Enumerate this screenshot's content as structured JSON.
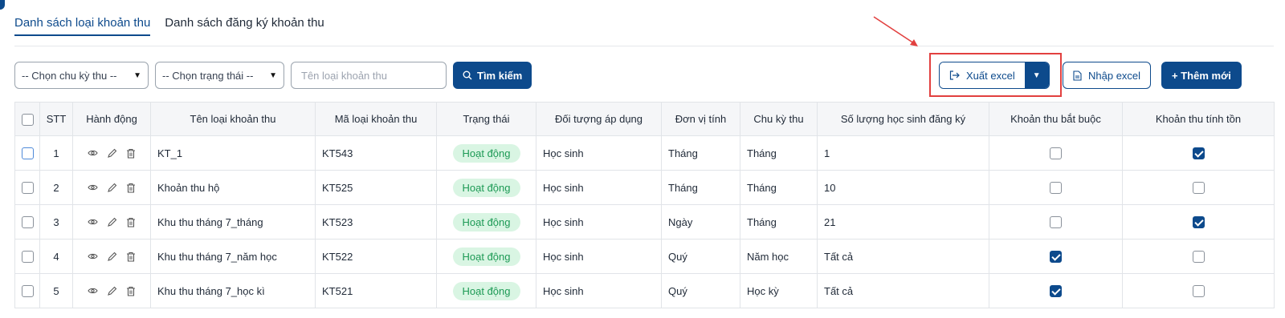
{
  "tabs": [
    {
      "label": "Danh sách loại khoản thu",
      "active": true
    },
    {
      "label": "Danh sách đăng ký khoản thu",
      "active": false
    }
  ],
  "filters": {
    "cycle_select": "-- Chọn chu kỳ thu --",
    "status_select": "-- Chọn trạng thái --",
    "name_placeholder": "Tên loại khoản thu",
    "search_label": "Tìm kiếm"
  },
  "actions": {
    "export_label": "Xuất excel",
    "import_label": "Nhập excel",
    "add_label": "+ Thêm mới"
  },
  "table": {
    "headers": [
      "STT",
      "Hành động",
      "Tên loại khoản thu",
      "Mã loại khoản thu",
      "Trạng thái",
      "Đối tượng áp dụng",
      "Đơn vị tính",
      "Chu kỳ thu",
      "Số lượng học sinh đăng ký",
      "Khoản thu bắt buộc",
      "Khoản thu tính tồn"
    ],
    "rows": [
      {
        "stt": "1",
        "name": "KT_1",
        "code": "KT543",
        "status": "Hoạt động",
        "target": "Học sinh",
        "unit": "Tháng",
        "cycle": "Tháng",
        "count": "1",
        "mandatory": false,
        "carry": true
      },
      {
        "stt": "2",
        "name": "Khoản thu hộ",
        "code": "KT525",
        "status": "Hoạt động",
        "target": "Học sinh",
        "unit": "Tháng",
        "cycle": "Tháng",
        "count": "10",
        "mandatory": false,
        "carry": false
      },
      {
        "stt": "3",
        "name": "Khu thu tháng 7_tháng",
        "code": "KT523",
        "status": "Hoạt động",
        "target": "Học sinh",
        "unit": "Ngày",
        "cycle": "Tháng",
        "count": "21",
        "mandatory": false,
        "carry": true
      },
      {
        "stt": "4",
        "name": "Khu thu tháng 7_năm học",
        "code": "KT522",
        "status": "Hoạt động",
        "target": "Học sinh",
        "unit": "Quý",
        "cycle": "Năm học",
        "count": "Tất cả",
        "mandatory": true,
        "carry": false
      },
      {
        "stt": "5",
        "name": "Khu thu tháng 7_học kì",
        "code": "KT521",
        "status": "Hoạt động",
        "target": "Học sinh",
        "unit": "Quý",
        "cycle": "Học kỳ",
        "count": "Tất cả",
        "mandatory": true,
        "carry": false
      }
    ]
  },
  "colors": {
    "primary": "#0d4a8c",
    "status_bg": "#d9f5e3",
    "status_text": "#1d9a55",
    "highlight": "#e2403f"
  }
}
